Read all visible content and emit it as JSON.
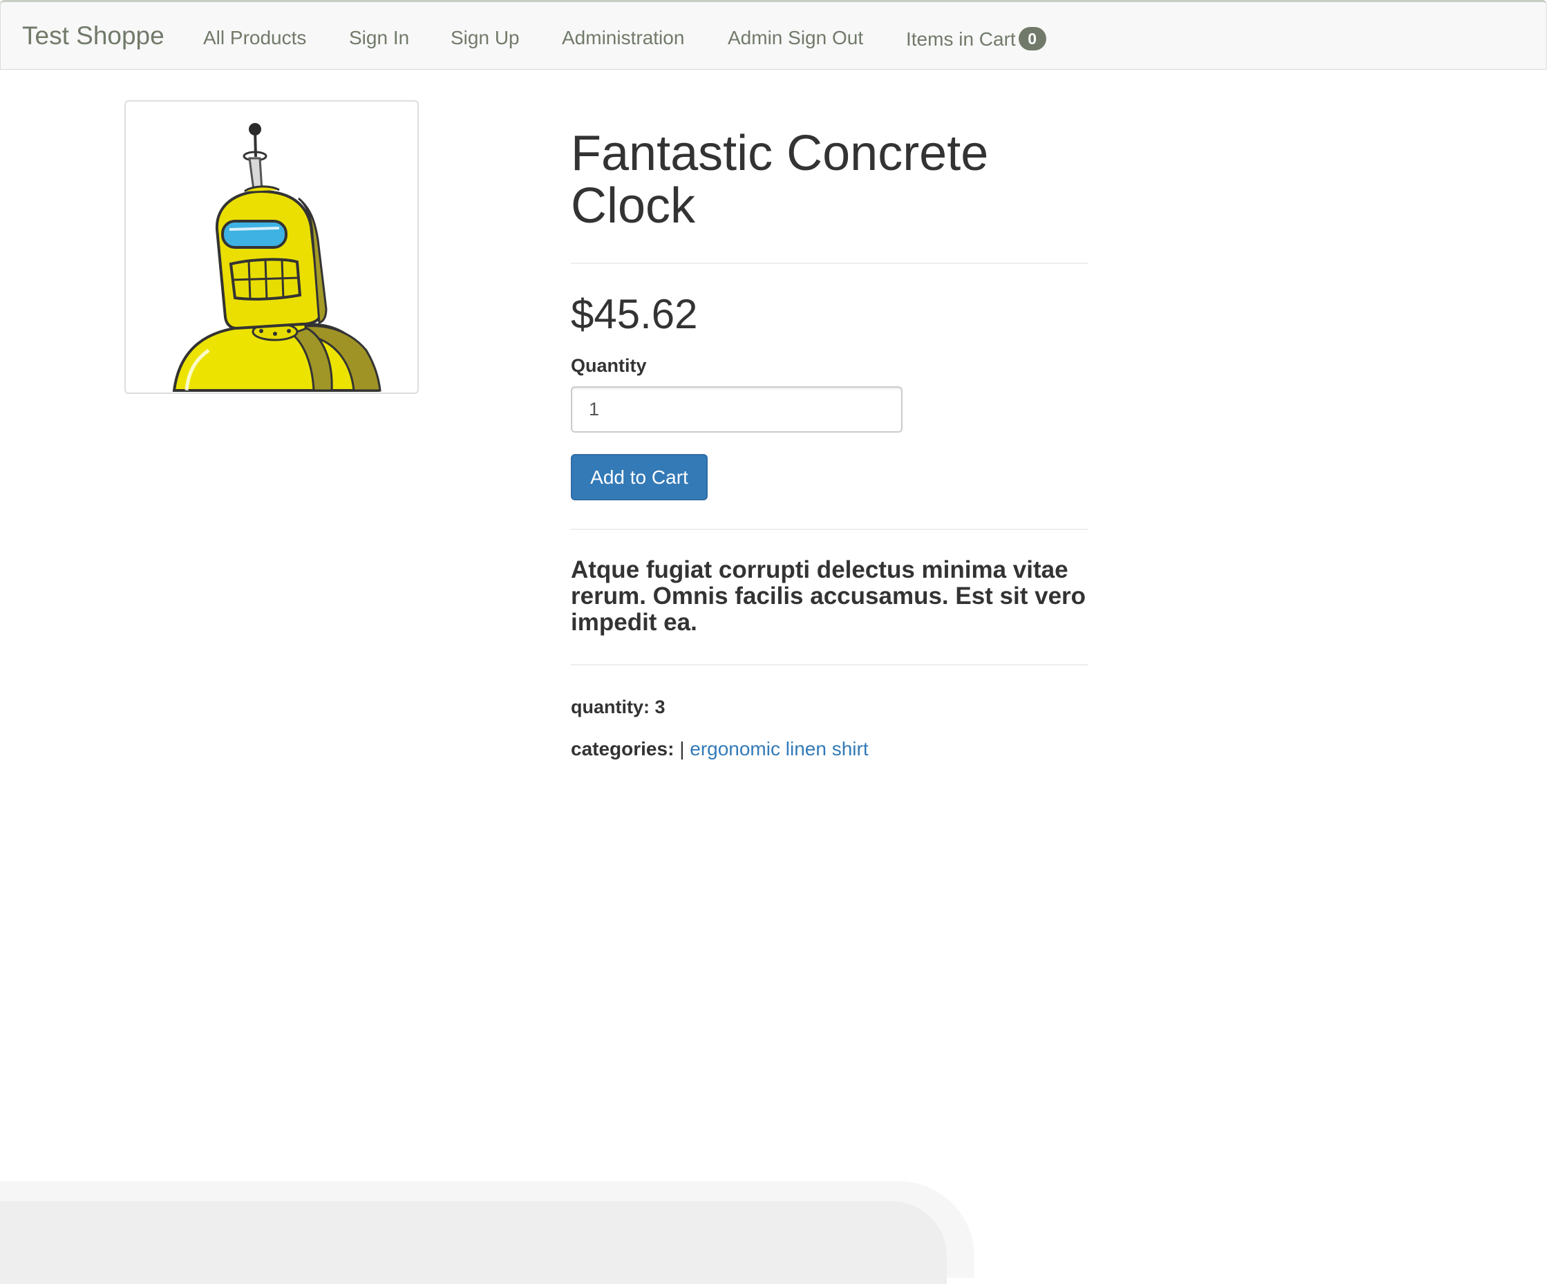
{
  "navbar": {
    "brand": "Test Shoppe",
    "items": [
      {
        "label": "All Products"
      },
      {
        "label": "Sign In"
      },
      {
        "label": "Sign Up"
      },
      {
        "label": "Administration"
      },
      {
        "label": "Admin Sign Out"
      }
    ],
    "cart": {
      "label": "Items in Cart",
      "count": "0"
    },
    "text_color": "#717a6a"
  },
  "product": {
    "image_icon": "robot-image",
    "title": "Fantastic Concrete Clock",
    "price": "$45.62",
    "quantity_label": "Quantity",
    "quantity_value": "1",
    "add_button_label": "Add to Cart",
    "description": "Atque fugiat corrupti delectus minima vitae rerum. Omnis facilis accusamus. Est sit vero impedit ea.",
    "stock_label": "quantity:",
    "stock_value": "3",
    "categories_label": "categories:",
    "categories_separator": "|",
    "categories": [
      "ergonomic linen shirt"
    ]
  },
  "colors": {
    "primary": "#337ab7",
    "link": "#337ab7",
    "text": "#333333"
  }
}
